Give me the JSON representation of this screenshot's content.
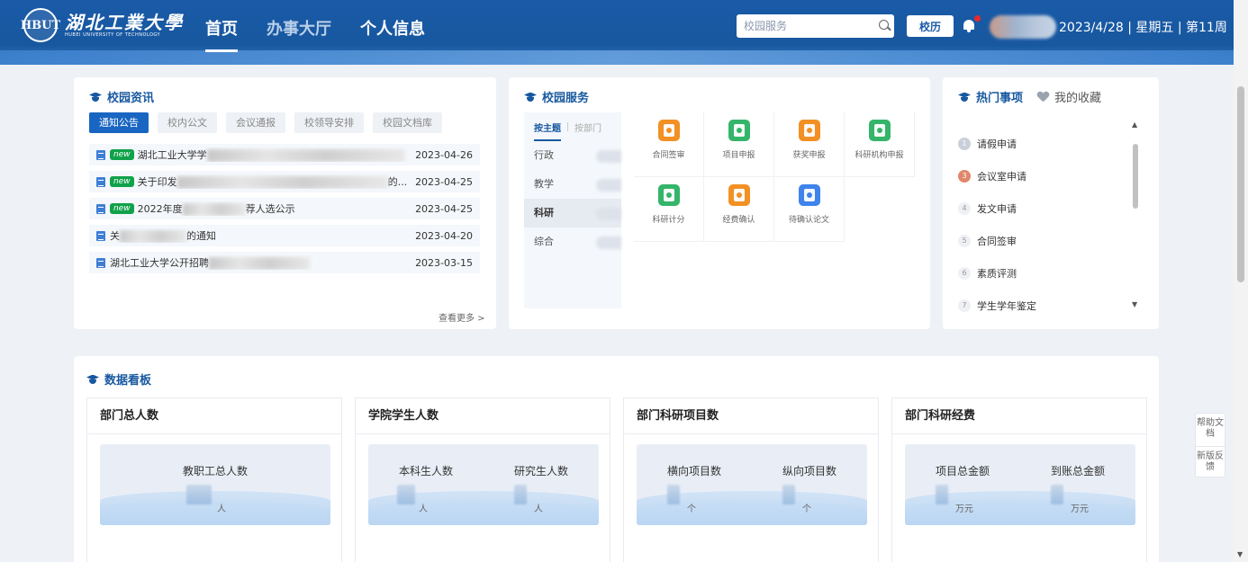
{
  "header": {
    "logo_initials": "HBUT",
    "logo_cn": "湖北工業大學",
    "logo_en": "HUBEI UNIVERSITY OF TECHNOLOGY",
    "nav": [
      {
        "label": "首页",
        "active": true
      },
      {
        "label": "办事大厅",
        "active": false
      },
      {
        "label": "个人信息",
        "active": false
      }
    ],
    "search_placeholder": "校园服务",
    "calendar_button": "校历",
    "date_text": "2023/4/28 | 星期五 | 第11周"
  },
  "news": {
    "title": "校园资讯",
    "tabs": [
      "通知公告",
      "校内公文",
      "会议通报",
      "校领导安排",
      "校园文档库"
    ],
    "new_label": "new",
    "items": [
      {
        "prefix": "湖北工业大学学",
        "suffix": "",
        "is_new": true,
        "date": "2023-04-26"
      },
      {
        "prefix": "关于印发",
        "suffix": "的...",
        "is_new": true,
        "date": "2023-04-25"
      },
      {
        "prefix": "2022年度",
        "suffix": "荐人选公示",
        "is_new": true,
        "date": "2023-04-25"
      },
      {
        "prefix": "关",
        "suffix": "的通知",
        "is_new": false,
        "date": "2023-04-20"
      },
      {
        "prefix": "湖北工业大学公开招聘",
        "suffix": "",
        "is_new": false,
        "date": "2023-03-15"
      }
    ],
    "more": "查看更多 >"
  },
  "services": {
    "title": "校园服务",
    "side_tabs": [
      "按主题",
      "按部门"
    ],
    "categories": [
      "行政",
      "教学",
      "科研",
      "综合"
    ],
    "active_category": "科研",
    "items": [
      {
        "label": "合同签审",
        "color": "orange"
      },
      {
        "label": "项目申报",
        "color": "green"
      },
      {
        "label": "获奖申报",
        "color": "orange"
      },
      {
        "label": "科研机构申报",
        "color": "green"
      },
      {
        "label": "科研计分",
        "color": "green"
      },
      {
        "label": "经费确认",
        "color": "orange"
      },
      {
        "label": "待确认论文",
        "color": "blue"
      }
    ]
  },
  "hot": {
    "title": "热门事项",
    "favorites": "我的收藏",
    "items": [
      {
        "rank": "1",
        "label": "请假申请"
      },
      {
        "rank": "3",
        "label": "会议室申请"
      },
      {
        "rank": "4",
        "label": "发文申请"
      },
      {
        "rank": "5",
        "label": "合同签审"
      },
      {
        "rank": "6",
        "label": "素质评测"
      },
      {
        "rank": "7",
        "label": "学生学年鉴定"
      }
    ]
  },
  "dashboard": {
    "title": "数据看板",
    "panels": [
      {
        "title": "部门总人数",
        "metrics": [
          {
            "label": "教职工总人数",
            "unit": "人"
          }
        ]
      },
      {
        "title": "学院学生人数",
        "metrics": [
          {
            "label": "本科生人数",
            "unit": "人"
          },
          {
            "label": "研究生人数",
            "unit": "人"
          }
        ]
      },
      {
        "title": "部门科研项目数",
        "metrics": [
          {
            "label": "横向项目数",
            "unit": "个"
          },
          {
            "label": "纵向项目数",
            "unit": "个"
          }
        ]
      },
      {
        "title": "部门科研经费",
        "metrics": [
          {
            "label": "项目总金额",
            "unit": "万元"
          },
          {
            "label": "到账总金额",
            "unit": "万元"
          }
        ]
      }
    ]
  },
  "float": {
    "help": "帮助文档",
    "feedback": "新版反馈"
  },
  "colors": {
    "brand": "#17589f",
    "accent": "#1966c2",
    "new_badge": "#10a24a"
  }
}
